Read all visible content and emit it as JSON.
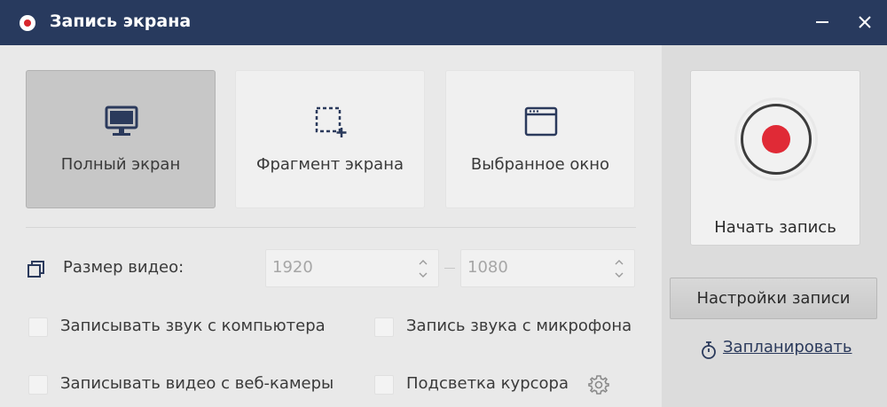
{
  "window": {
    "title": "Запись экрана",
    "minimize_icon": "minimize-icon",
    "close_icon": "close-icon",
    "title_colors": {
      "bar": "#283a5e",
      "record_dot": "#d8262c"
    }
  },
  "modes": [
    {
      "id": "full",
      "label": "Полный экран",
      "icon": "monitor-icon",
      "selected": true
    },
    {
      "id": "fragment",
      "label": "Фрагмент экрана",
      "icon": "region-select-icon",
      "selected": false
    },
    {
      "id": "window",
      "label": "Выбранное окно",
      "icon": "window-icon",
      "selected": false
    }
  ],
  "video_size": {
    "label": "Размер видео:",
    "icon": "video-size-icon",
    "width": "1920",
    "height": "1080"
  },
  "options": [
    {
      "label": "Записывать звук с компьютера",
      "checked": false
    },
    {
      "label": "Запись звука с микрофона",
      "checked": false
    },
    {
      "label": "Записывать видео с веб-камеры",
      "checked": false
    },
    {
      "label": "Подсветка курсора",
      "checked": false,
      "settings_icon": "gear-icon"
    }
  ],
  "record": {
    "label": "Начать запись",
    "icon": "record-icon",
    "accent": "#e02a36"
  },
  "settings_button": {
    "label": "Настройки записи"
  },
  "schedule": {
    "label": "Запланировать",
    "icon": "stopwatch-icon"
  }
}
